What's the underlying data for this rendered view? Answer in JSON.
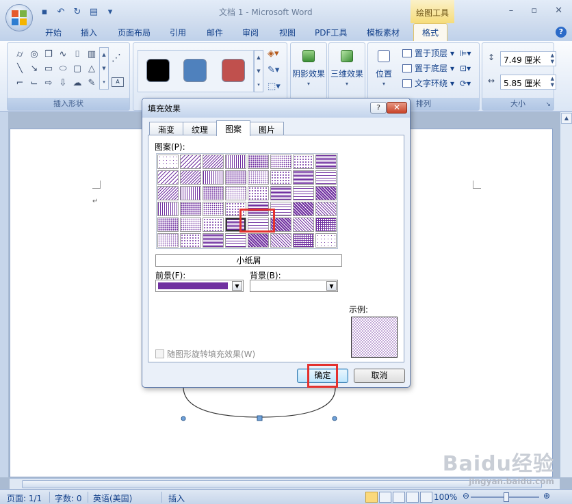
{
  "titlebar": {
    "doc_title": "文档 1 - Microsoft Word",
    "context_group": "绘图工具"
  },
  "ribbon_tabs": [
    "开始",
    "插入",
    "页面布局",
    "引用",
    "邮件",
    "审阅",
    "视图",
    "PDF工具",
    "模板素材",
    "格式"
  ],
  "ribbon_active_tab": "格式",
  "groups": {
    "insert_shapes": "插入形状",
    "shadow_effects": "阴影效果",
    "threed_effects": "三维效果",
    "position": "位置",
    "arrange": "排列",
    "size": "大小",
    "bring_to_front": "置于顶层",
    "send_to_back": "置于底层",
    "text_wrap": "文字环绕"
  },
  "shape_styles": {
    "swatch_colors": [
      "#000000",
      "#4f81bd",
      "#c0504d"
    ]
  },
  "size": {
    "height_value": "7.49 厘米",
    "width_value": "5.85 厘米"
  },
  "dialog": {
    "title": "填充效果",
    "tabs": [
      "渐变",
      "纹理",
      "图案",
      "图片"
    ],
    "active_tab": "图案",
    "pattern_label": "图案(P):",
    "selected_pattern_name": "小纸屑",
    "foreground_label": "前景(F):",
    "background_label": "背景(B):",
    "foreground_color": "#7030a0",
    "background_color": "#ffffff",
    "example_label": "示例:",
    "rotate_checkbox_label": "随图形旋转填充效果(W)",
    "ok_label": "确定",
    "cancel_label": "取消"
  },
  "statusbar": {
    "page": "页面: 1/1",
    "words": "字数: 0",
    "language": "英语(美国)",
    "mode": "插入",
    "zoom": "100%"
  },
  "watermark": {
    "brand": "Baidu经验",
    "url": "jingyan.baidu.com"
  }
}
